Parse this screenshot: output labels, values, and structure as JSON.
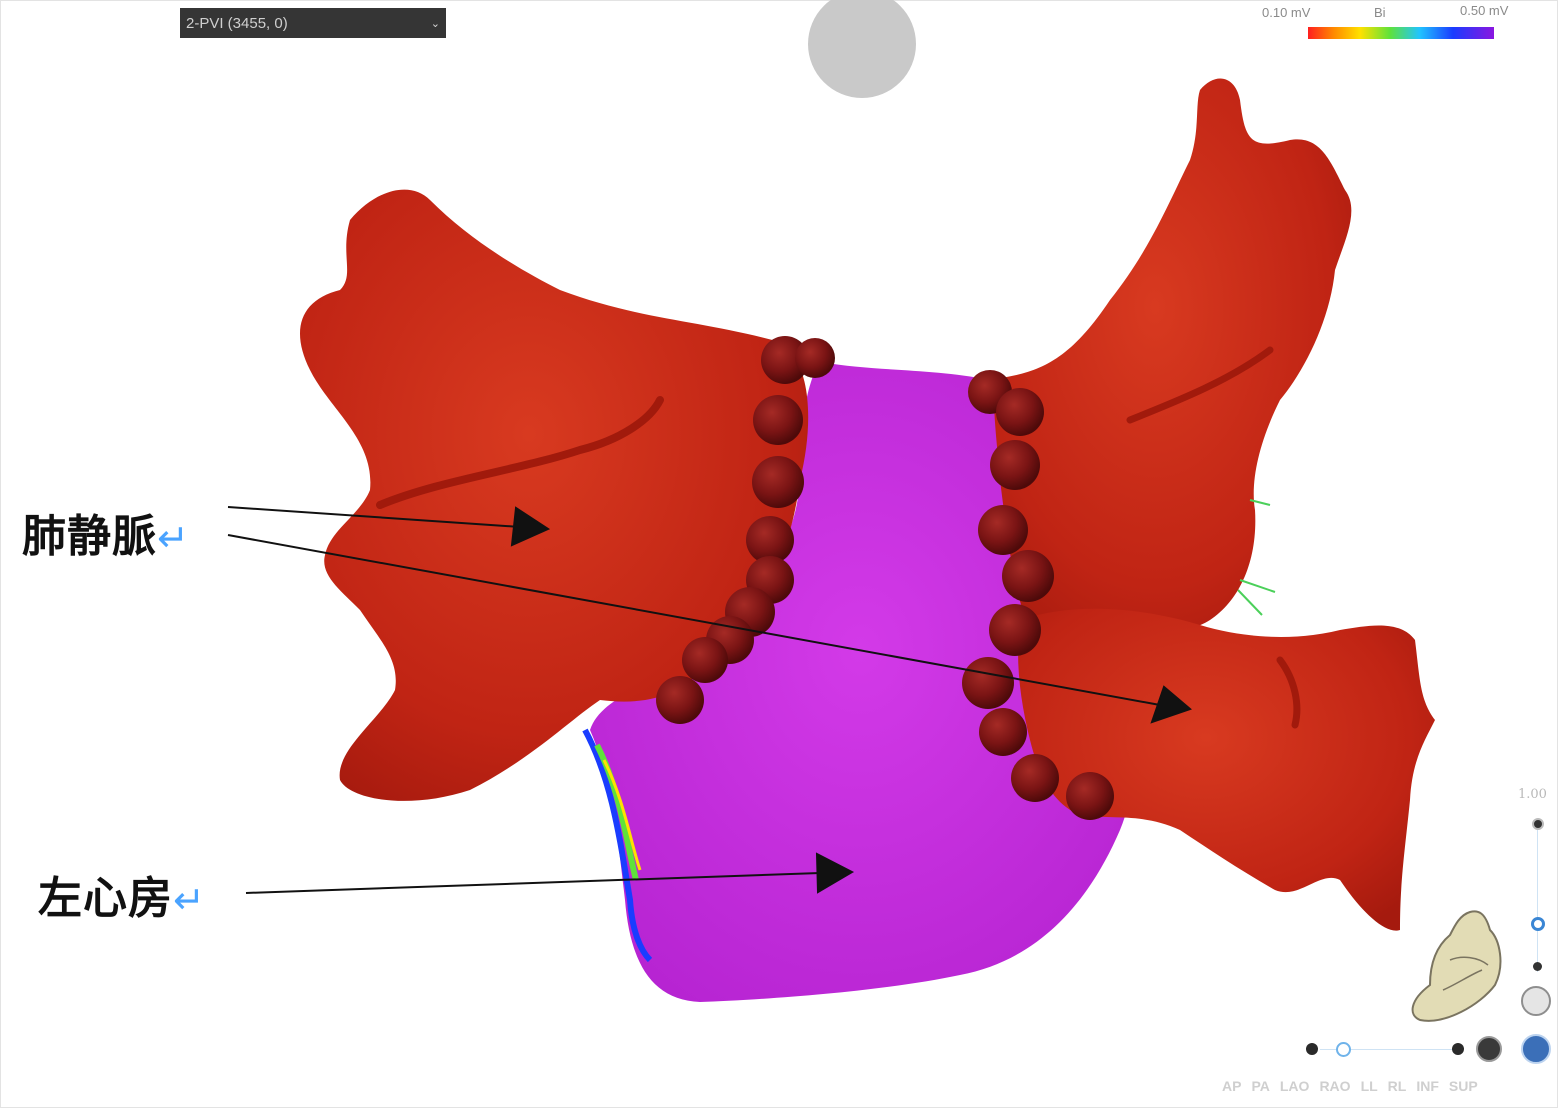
{
  "toolbar": {
    "map_selector_value": "2-PVI (3455, 0)"
  },
  "color_scale": {
    "min_label": "0.10 mV",
    "mode_label": "Bi",
    "max_label": "0.50 mV",
    "colors": [
      "#ff1f1f",
      "#ff8a00",
      "#ffe100",
      "#5fe23a",
      "#21c4ff",
      "#1a3cff",
      "#8a16e0"
    ]
  },
  "annotations": {
    "pulmonary_vein_label": "肺静脈",
    "left_atrium_label": "左心房",
    "return_mark": "↵"
  },
  "opacity_slider": {
    "value_label": "1.00"
  },
  "view_buttons": [
    "AP",
    "PA",
    "LAO",
    "RAO",
    "LL",
    "RL",
    "INF",
    "SUP"
  ],
  "colors": {
    "pv_red": "#c42514",
    "atrium_magenta": "#c62ee0",
    "ablation_lesion": "#7a1414"
  }
}
